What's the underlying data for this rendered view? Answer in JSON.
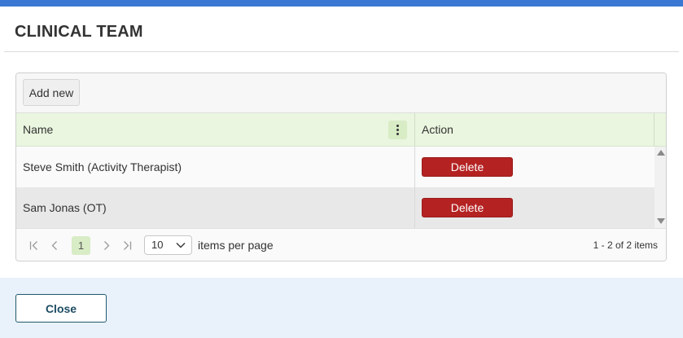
{
  "dialog": {
    "title": "CLINICAL TEAM"
  },
  "toolbar": {
    "add_label": "Add new"
  },
  "grid": {
    "columns": [
      {
        "label": "Name"
      },
      {
        "label": "Action"
      }
    ],
    "rows": [
      {
        "name": "Steve Smith (Activity Therapist)",
        "action_label": "Delete"
      },
      {
        "name": "Sam Jonas (OT)",
        "action_label": "Delete"
      }
    ]
  },
  "pager": {
    "current_page": "1",
    "page_size": "10",
    "items_per_page_label": "items per page",
    "info": "1 - 2 of 2 items"
  },
  "footer": {
    "close_label": "Close"
  },
  "colors": {
    "accent_bar": "#3a78d4",
    "header_bg": "#eaf6df",
    "delete_bg": "#b42222",
    "footer_bg": "#e9f1fb",
    "close_border": "#1f5a6e"
  },
  "icons": {
    "column_menu": "vertical-dots-icon",
    "first": "first-page-icon",
    "prev": "chevron-left-icon",
    "next": "chevron-right-icon",
    "last": "last-page-icon",
    "size_dropdown": "chevron-down-icon",
    "scroll_up": "arrow-up-icon",
    "scroll_down": "arrow-down-icon"
  }
}
